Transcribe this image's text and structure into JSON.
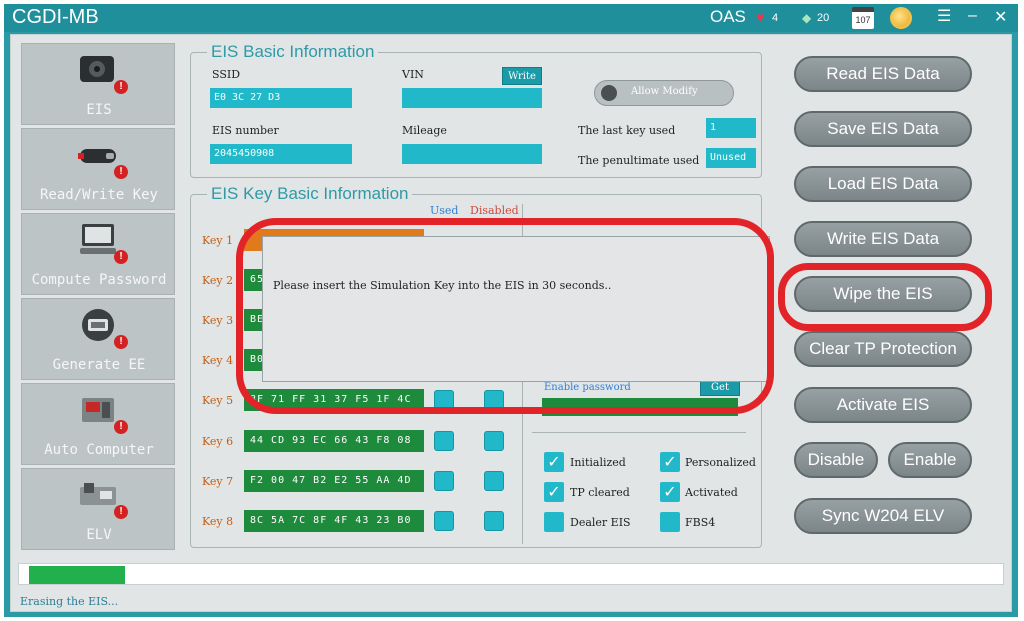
{
  "window": {
    "title": "CGDI-MB",
    "user": "OAS",
    "hearts": "4",
    "gems": "20",
    "calendar": "107",
    "icons": [
      "heart-icon",
      "gem-icon",
      "calendar-icon",
      "medal-icon",
      "menu-icon",
      "minimize-icon",
      "close-icon"
    ]
  },
  "sidebar": {
    "items": [
      {
        "label": "EIS",
        "icon": "ignition-icon"
      },
      {
        "label": "Read/Write Key",
        "icon": "key-icon"
      },
      {
        "label": "Compute Password",
        "icon": "computer-icon"
      },
      {
        "label": "Generate EE",
        "icon": "chip-icon"
      },
      {
        "label": "Auto Computer",
        "icon": "ecu-icon"
      },
      {
        "label": "ELV",
        "icon": "elv-module-icon"
      }
    ],
    "badge": "!"
  },
  "eis_basic": {
    "title": "EIS Basic Information",
    "ssid_label": "SSID",
    "ssid_value": "E0 3C 27 D3",
    "vin_label": "VIN",
    "vin_value": "",
    "write_label": "Write",
    "eis_number_label": "EIS number",
    "eis_number_value": "2045450908",
    "mileage_label": "Mileage",
    "mileage_value": "",
    "allow_modify_label": "Allow Modify",
    "last_key_label": "The last key used",
    "last_key_value": "1",
    "penultimate_label": "The penultimate used",
    "penultimate_value": "Unused"
  },
  "eis_keys": {
    "title": "EIS Key Basic Information",
    "used_header": "Used",
    "disabled_header": "Disabled",
    "keys": [
      {
        "label": "Key 1",
        "value": "",
        "highlight": true
      },
      {
        "label": "Key 2",
        "value": "65",
        "highlight": false
      },
      {
        "label": "Key 3",
        "value": "BE",
        "highlight": false
      },
      {
        "label": "Key 4",
        "value": "B0",
        "highlight": false
      },
      {
        "label": "Key 5",
        "value": "8F 71 FF 31 37 F5 1F 4C",
        "highlight": false
      },
      {
        "label": "Key 6",
        "value": "44 CD 93 EC 66 43 F8 08",
        "highlight": false
      },
      {
        "label": "Key 7",
        "value": "F2 00 47 B2 E2 55 AA 4D",
        "highlight": false
      },
      {
        "label": "Key 8",
        "value": "8C 5A 7C 8F 4F 43 23 B0",
        "highlight": false
      }
    ],
    "enable_password_label": "Enable password",
    "get_label": "Get",
    "checkboxes": [
      {
        "label": "Initialized",
        "checked": true
      },
      {
        "label": "Personalized",
        "checked": true
      },
      {
        "label": "TP cleared",
        "checked": true
      },
      {
        "label": "Activated",
        "checked": true
      },
      {
        "label": "Dealer EIS",
        "checked": false
      },
      {
        "label": "FBS4",
        "checked": false
      }
    ]
  },
  "actions": {
    "read": "Read  EIS Data",
    "save": "Save EIS Data",
    "load": "Load EIS Data",
    "write": "Write EIS Data",
    "wipe": "Wipe the EIS",
    "clear_tp": "Clear TP Protection",
    "activate": "Activate EIS",
    "disable": "Disable",
    "enable": "Enable",
    "sync": "Sync W204 ELV"
  },
  "dialog": {
    "message": "Please insert the Simulation Key into the EIS in 30 seconds.."
  },
  "progress": {
    "fraction": 0.1,
    "status": "Erasing the EIS..."
  },
  "colors": {
    "accent": "#21b9c9",
    "key_green": "#1e8a3c",
    "highlight_red": "#e22328"
  }
}
